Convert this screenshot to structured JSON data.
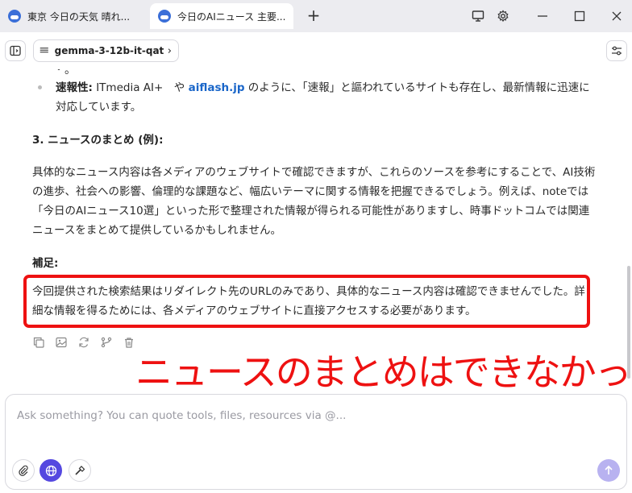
{
  "tabs": [
    {
      "title": "東京 今日の天気 晴れ..."
    },
    {
      "title": "今日のAIニュース 主要..."
    }
  ],
  "tab_add": "+",
  "toolbar": {
    "model_glyph": "𝄘",
    "model_name": "gemma-3-12b-it-qat",
    "model_chevron": "›"
  },
  "message": {
    "cut_text": "・。",
    "bullet": {
      "label": "速報性:",
      "text_1": " ITmedia AI+　や ",
      "link": "aiflash.jp",
      "text_2": " のように、「速報」と謳われているサイトも存在し、最新情報に迅速に対応しています。"
    },
    "section_heading": "3. ニュースのまとめ (例):",
    "body": "具体的なニュース内容は各メディアのウェブサイトで確認できますが、これらのソースを参考にすることで、AI技術の進歩、社会への影響、倫理的な課題など、幅広いテーマに関する情報を把握できるでしょう。例えば、noteでは「今日のAIニュース10選」といった形で整理された情報が得られる可能性がありますし、時事ドットコムでは関連ニュースをまとめて提供しているかもしれません。",
    "note_heading": "補足:",
    "note": "今回提供された検索結果はリダイレクト先のURLのみであり、具体的なニュース内容は確認できませんでした。詳細な情報を得るためには、各メディアのウェブサイトに直接アクセスする必要があります。"
  },
  "annotation": "ニュースのまとめはできなかった",
  "composer": {
    "placeholder": "Ask something? You can quote tools, files, resources via @..."
  },
  "colors": {
    "accent": "#5548e0",
    "annotation_red": "#ee1111",
    "link": "#1a66c9"
  }
}
